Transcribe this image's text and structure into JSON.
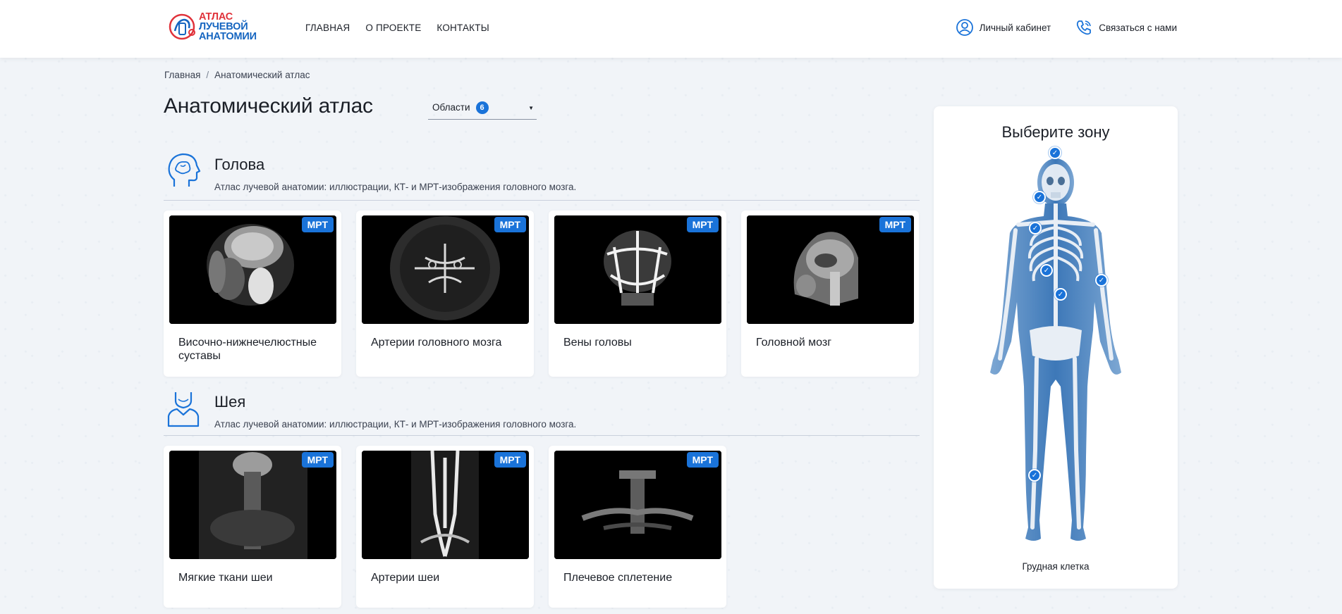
{
  "header": {
    "logo": {
      "line1": "АТЛАС",
      "line2": "ЛУЧЕВОЙ",
      "line3": "АНАТОМИИ"
    },
    "nav": [
      "ГЛАВНАЯ",
      "О ПРОЕКТЕ",
      "КОНТАКТЫ"
    ],
    "account_label": "Личный кабинет",
    "contact_label": "Связаться с нами"
  },
  "breadcrumb": {
    "home": "Главная",
    "separator": "/",
    "current": "Анатомический атлас"
  },
  "page_title": "Анатомический атлас",
  "areas_filter": {
    "label": "Области",
    "count": "6"
  },
  "sections": [
    {
      "title": "Голова",
      "description": "Атлас лучевой анатомии: иллюстрации, КТ- и МРТ-изображения головного мозга.",
      "cards": [
        {
          "label": "Височно-нижнечелюстные суставы",
          "badge": "МРТ"
        },
        {
          "label": "Артерии головного мозга",
          "badge": "МРТ"
        },
        {
          "label": "Вены головы",
          "badge": "МРТ"
        },
        {
          "label": "Головной мозг",
          "badge": "МРТ"
        }
      ]
    },
    {
      "title": "Шея",
      "description": "Атлас лучевой анатомии: иллюстрации, КТ- и МРТ-изображения головного мозга.",
      "cards": [
        {
          "label": "Мягкие ткани шеи",
          "badge": "МРТ"
        },
        {
          "label": "Артерии шеи",
          "badge": "МРТ"
        },
        {
          "label": "Плечевое сплетение",
          "badge": "МРТ"
        }
      ]
    }
  ],
  "zone_panel": {
    "title": "Выберите зону",
    "selected_zone": "Грудная клетка"
  },
  "colors": {
    "accent": "#1a73d9",
    "logo_red": "#e0323a",
    "logo_blue": "#1565c0"
  }
}
